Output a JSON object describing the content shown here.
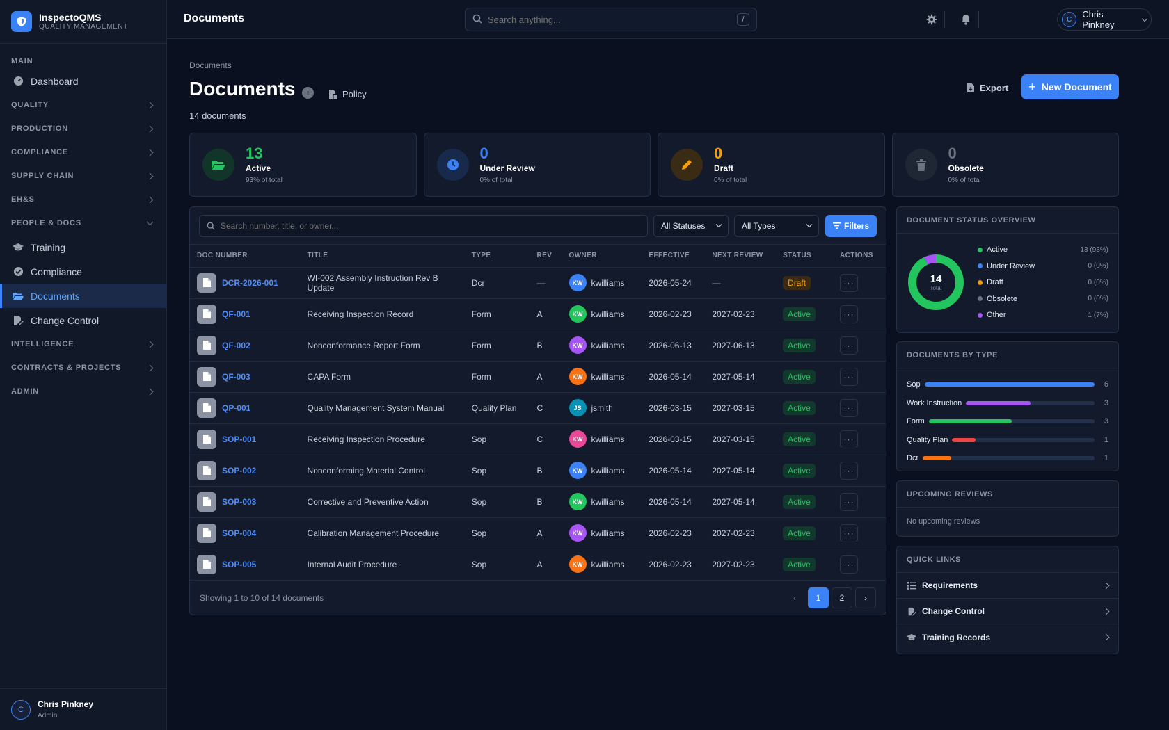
{
  "brand": {
    "name": "InspectoQMS",
    "subtitle": "QUALITY MANAGEMENT"
  },
  "sidebar": {
    "main_heading": "MAIN",
    "dashboard": "Dashboard",
    "sections": [
      "QUALITY",
      "PRODUCTION",
      "COMPLIANCE",
      "SUPPLY CHAIN",
      "EH&S"
    ],
    "people_heading": "PEOPLE & DOCS",
    "people_items": [
      "Training",
      "Compliance",
      "Documents",
      "Change Control"
    ],
    "lower_sections": [
      "INTELLIGENCE",
      "CONTRACTS & PROJECTS",
      "ADMIN"
    ],
    "user": {
      "name": "Chris Pinkney",
      "role": "Admin",
      "initial": "C"
    }
  },
  "topbar": {
    "title": "Documents",
    "search_placeholder": "Search anything...",
    "search_shortcut": "/",
    "user_name": "Chris Pinkney",
    "user_initial": "C"
  },
  "page": {
    "breadcrumb": "Documents",
    "title": "Documents",
    "policy_label": "Policy",
    "count_text": "14 documents",
    "export_label": "Export",
    "new_label": "New Document"
  },
  "stats": [
    {
      "value": "13",
      "label": "Active",
      "sub": "93% of total",
      "color": "#22c55e",
      "bg": "#12352a"
    },
    {
      "value": "0",
      "label": "Under Review",
      "sub": "0% of total",
      "color": "#3b82f6",
      "bg": "#172a4c"
    },
    {
      "value": "0",
      "label": "Draft",
      "sub": "0% of total",
      "color": "#f59e0b",
      "bg": "#3a2c14"
    },
    {
      "value": "0",
      "label": "Obsolete",
      "sub": "0% of total",
      "color": "#6b7280",
      "bg": "#1f2735"
    }
  ],
  "table": {
    "search_placeholder": "Search number, title, or owner...",
    "status_filter": "All Statuses",
    "type_filter": "All Types",
    "filters_label": "Filters",
    "columns": [
      "DOC NUMBER",
      "TITLE",
      "TYPE",
      "REV",
      "OWNER",
      "EFFECTIVE",
      "NEXT REVIEW",
      "STATUS",
      "ACTIONS"
    ],
    "rows": [
      {
        "num": "DCR-2026-001",
        "title": "WI-002 Assembly Instruction Rev B Update",
        "type": "Dcr",
        "rev": "—",
        "initials": "KW",
        "color": "#3b82f6",
        "owner": "kwilliams",
        "eff": "2026-05-24",
        "next": "—",
        "status": "Draft"
      },
      {
        "num": "QF-001",
        "title": "Receiving Inspection Record",
        "type": "Form",
        "rev": "A",
        "initials": "KW",
        "color": "#22c55e",
        "owner": "kwilliams",
        "eff": "2026-02-23",
        "next": "2027-02-23",
        "status": "Active"
      },
      {
        "num": "QF-002",
        "title": "Nonconformance Report Form",
        "type": "Form",
        "rev": "B",
        "initials": "KW",
        "color": "#a855f7",
        "owner": "kwilliams",
        "eff": "2026-06-13",
        "next": "2027-06-13",
        "status": "Active"
      },
      {
        "num": "QF-003",
        "title": "CAPA Form",
        "type": "Form",
        "rev": "A",
        "initials": "KW",
        "color": "#f97316",
        "owner": "kwilliams",
        "eff": "2026-05-14",
        "next": "2027-05-14",
        "status": "Active"
      },
      {
        "num": "QP-001",
        "title": "Quality Management System Manual",
        "type": "Quality Plan",
        "rev": "C",
        "initials": "JS",
        "color": "#0891b2",
        "owner": "jsmith",
        "eff": "2026-03-15",
        "next": "2027-03-15",
        "status": "Active"
      },
      {
        "num": "SOP-001",
        "title": "Receiving Inspection Procedure",
        "type": "Sop",
        "rev": "C",
        "initials": "KW",
        "color": "#ec4899",
        "owner": "kwilliams",
        "eff": "2026-03-15",
        "next": "2027-03-15",
        "status": "Active"
      },
      {
        "num": "SOP-002",
        "title": "Nonconforming Material Control",
        "type": "Sop",
        "rev": "B",
        "initials": "KW",
        "color": "#3b82f6",
        "owner": "kwilliams",
        "eff": "2026-05-14",
        "next": "2027-05-14",
        "status": "Active"
      },
      {
        "num": "SOP-003",
        "title": "Corrective and Preventive Action",
        "type": "Sop",
        "rev": "B",
        "initials": "KW",
        "color": "#22c55e",
        "owner": "kwilliams",
        "eff": "2026-05-14",
        "next": "2027-05-14",
        "status": "Active"
      },
      {
        "num": "SOP-004",
        "title": "Calibration Management Procedure",
        "type": "Sop",
        "rev": "A",
        "initials": "KW",
        "color": "#a855f7",
        "owner": "kwilliams",
        "eff": "2026-02-23",
        "next": "2027-02-23",
        "status": "Active"
      },
      {
        "num": "SOP-005",
        "title": "Internal Audit Procedure",
        "type": "Sop",
        "rev": "A",
        "initials": "KW",
        "color": "#f97316",
        "owner": "kwilliams",
        "eff": "2026-02-23",
        "next": "2027-02-23",
        "status": "Active"
      }
    ],
    "action_glyph": "···",
    "showing_text": "Showing 1 to 10 of 14 documents",
    "pages": [
      "1",
      "2"
    ],
    "prev": "‹",
    "next": "›"
  },
  "status_overview": {
    "title": "DOCUMENT STATUS OVERVIEW",
    "total": "14",
    "total_label": "Total",
    "items": [
      {
        "label": "Active",
        "value": "13 (93%)",
        "count": 13,
        "color": "#22c55e"
      },
      {
        "label": "Under Review",
        "value": "0 (0%)",
        "count": 0,
        "color": "#3b82f6"
      },
      {
        "label": "Draft",
        "value": "0 (0%)",
        "count": 0,
        "color": "#f59e0b"
      },
      {
        "label": "Obsolete",
        "value": "0 (0%)",
        "count": 0,
        "color": "#6b7280"
      },
      {
        "label": "Other",
        "value": "1 (7%)",
        "count": 1,
        "color": "#a855f7"
      }
    ]
  },
  "by_type": {
    "title": "DOCUMENTS BY TYPE",
    "max": 6,
    "items": [
      {
        "label": "Sop",
        "count": 6,
        "color": "#3b82f6"
      },
      {
        "label": "Work Instruction",
        "count": 3,
        "color": "#a855f7"
      },
      {
        "label": "Form",
        "count": 3,
        "color": "#22c55e"
      },
      {
        "label": "Quality Plan",
        "count": 1,
        "color": "#ef4444"
      },
      {
        "label": "Dcr",
        "count": 1,
        "color": "#f97316"
      }
    ]
  },
  "upcoming": {
    "title": "UPCOMING REVIEWS",
    "empty": "No upcoming reviews"
  },
  "quick_links": {
    "title": "QUICK LINKS",
    "items": [
      "Requirements",
      "Change Control",
      "Training Records"
    ]
  }
}
